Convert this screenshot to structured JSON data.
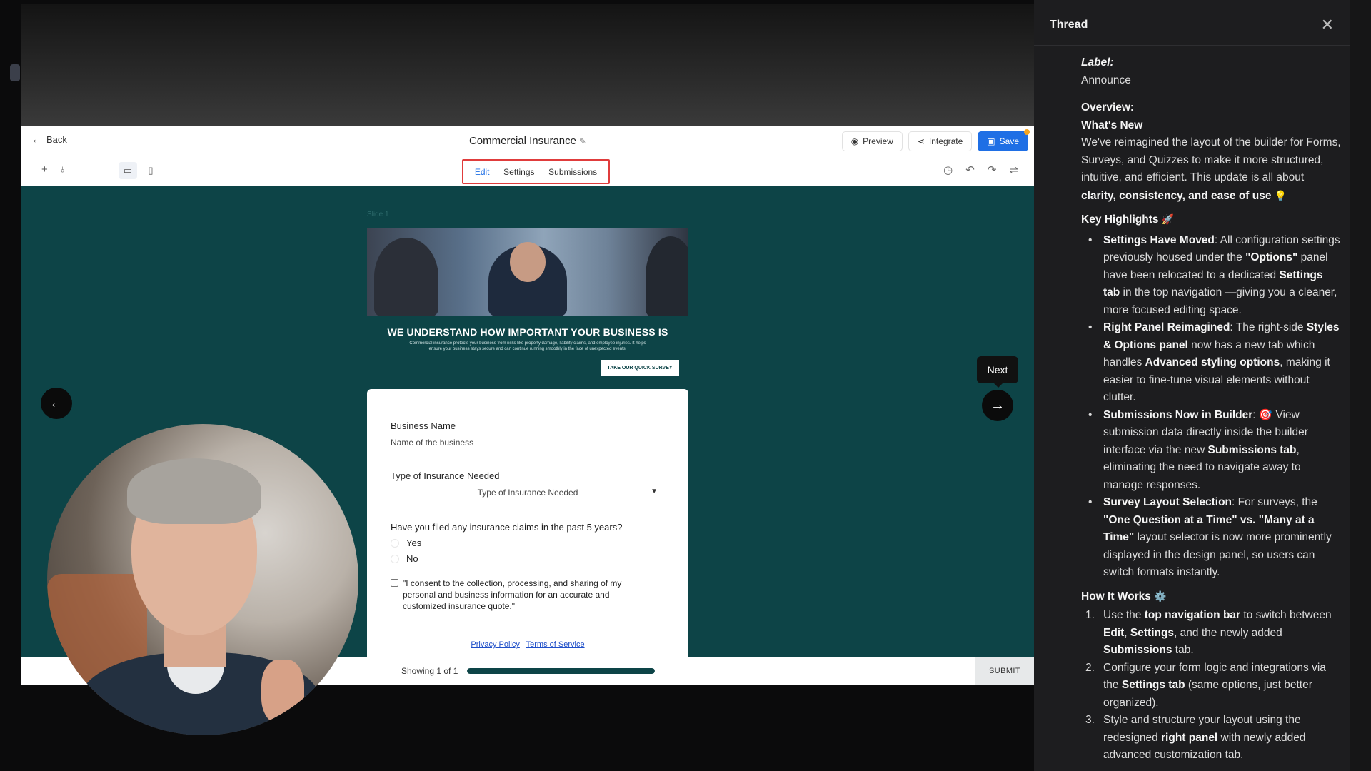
{
  "builder": {
    "back_label": "Back",
    "doc_title": "Commercial Insurance",
    "actions": {
      "preview": "Preview",
      "integrate": "Integrate",
      "save": "Save"
    },
    "tabs": [
      {
        "label": "Edit",
        "active": true
      },
      {
        "label": "Settings",
        "active": false
      },
      {
        "label": "Submissions",
        "active": false
      }
    ]
  },
  "canvas": {
    "slide_label": "Slide 1",
    "headline": "WE UNDERSTAND HOW IMPORTANT YOUR BUSINESS IS",
    "subline": "Commercial insurance protects your business from risks like property damage, liability claims, and employee injuries. It helps ensure your business stays secure and can continue running smoothly in the face of unexpected events.",
    "survey_button": "TAKE OUR QUICK SURVEY",
    "next_tooltip": "Next",
    "form": {
      "business_name_label": "Business Name",
      "business_name_placeholder": "Name of the business",
      "insurance_type_label": "Type of Insurance Needed",
      "insurance_type_selected": "Type of Insurance Needed",
      "claims_question": "Have you filed any insurance claims in the past 5 years?",
      "option_yes": "Yes",
      "option_no": "No",
      "consent_text": "\"I consent to the collection, processing, and sharing of my personal and business information for an accurate and customized insurance quote.\"",
      "privacy_link": "Privacy Policy",
      "link_separator": "|",
      "terms_link": "Terms of Service"
    },
    "footer": {
      "progress_text": "Showing 1 of 1",
      "progress_fraction": 1.0,
      "submit_label": "SUBMIT"
    }
  },
  "thread": {
    "title": "Thread",
    "label_key": "Label",
    "label_value": "Announce",
    "overview_key": "Overview:",
    "whats_new": "What's New",
    "intro_text": "We've reimagined the layout of the builder for Forms, Surveys, and Quizzes to make it more structured, intuitive, and efficient. This update is all about",
    "intro_bold": "clarity, consistency, and ease of use",
    "intro_emoji": "💡",
    "highlights_title": "Key Highlights",
    "highlights_emoji": "🚀",
    "highlights": [
      {
        "head": "Settings Have Moved",
        "parts": [
          ": All configuration settings previously housed under the ",
          "\"Options\"",
          " panel have been relocated to a dedicated ",
          "Settings tab",
          " in the top navigation —giving you a cleaner, more focused editing space."
        ]
      },
      {
        "head": "Right Panel Reimagined",
        "parts": [
          ": The right-side ",
          "Styles & Options panel",
          " now has a new tab which handles ",
          "Advanced styling options",
          ", making it easier to fine-tune visual elements without clutter."
        ]
      },
      {
        "head": "Submissions Now in Builder",
        "parts": [
          ": 🎯 View submission data directly inside the builder interface via the new ",
          "Submissions tab",
          ", eliminating the need to navigate away to manage responses."
        ]
      },
      {
        "head": "Survey Layout Selection",
        "parts": [
          ": For surveys, the ",
          "\"One Question at a Time\" vs. \"Many at a Time\"",
          " layout selector is now more prominently displayed in the design panel, so users can switch formats instantly."
        ]
      }
    ],
    "how_title": "How It Works",
    "how_emoji": "⚙️",
    "steps": [
      {
        "num": "1.",
        "parts": [
          "Use the ",
          "top navigation bar",
          " to switch between ",
          "Edit",
          ", ",
          "Settings",
          ", and the newly added ",
          "Submissions",
          " tab."
        ]
      },
      {
        "num": "2.",
        "parts": [
          "Configure your form logic and integrations via the ",
          "Settings tab",
          " (same options, just better organized)."
        ]
      },
      {
        "num": "3.",
        "parts": [
          "Style and structure your layout using the redesigned ",
          "right panel",
          " with newly added advanced customization tab."
        ]
      }
    ]
  }
}
